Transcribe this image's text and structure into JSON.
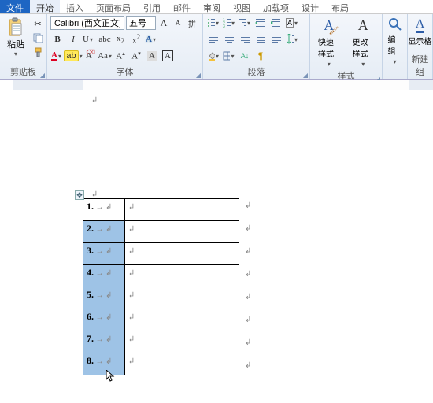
{
  "tabs": {
    "file": "文件",
    "home": "开始",
    "insert": "插入",
    "pagelayout": "页面布局",
    "references": "引用",
    "mailings": "邮件",
    "review": "审阅",
    "view": "视图",
    "addins": "加载项",
    "design": "设计",
    "layout": "布局"
  },
  "clipboard": {
    "paste": "粘贴",
    "group": "剪贴板"
  },
  "font": {
    "name": "Calibri (西文正文)",
    "size": "五号",
    "grow": "A",
    "shrink": "A",
    "bold": "B",
    "italic": "I",
    "underline": "U",
    "strike": "abc",
    "sub": "x",
    "sup": "x",
    "highlight": "ab",
    "caseAa": "Aa",
    "clear": "A",
    "charshade": "A",
    "colorA": "A",
    "glyphA": "A",
    "group": "字体",
    "pinyin": "拼"
  },
  "paragraph": {
    "group": "段落"
  },
  "styles": {
    "quick": "快速样式",
    "change": "更改样式",
    "group": "样式"
  },
  "editing": {
    "find": "编辑",
    "group": "新建组",
    "showfmt": "显示格"
  },
  "table": {
    "rows": [
      {
        "n": "1."
      },
      {
        "n": "2."
      },
      {
        "n": "3."
      },
      {
        "n": "4."
      },
      {
        "n": "5."
      },
      {
        "n": "6."
      },
      {
        "n": "7."
      },
      {
        "n": "8."
      }
    ]
  }
}
